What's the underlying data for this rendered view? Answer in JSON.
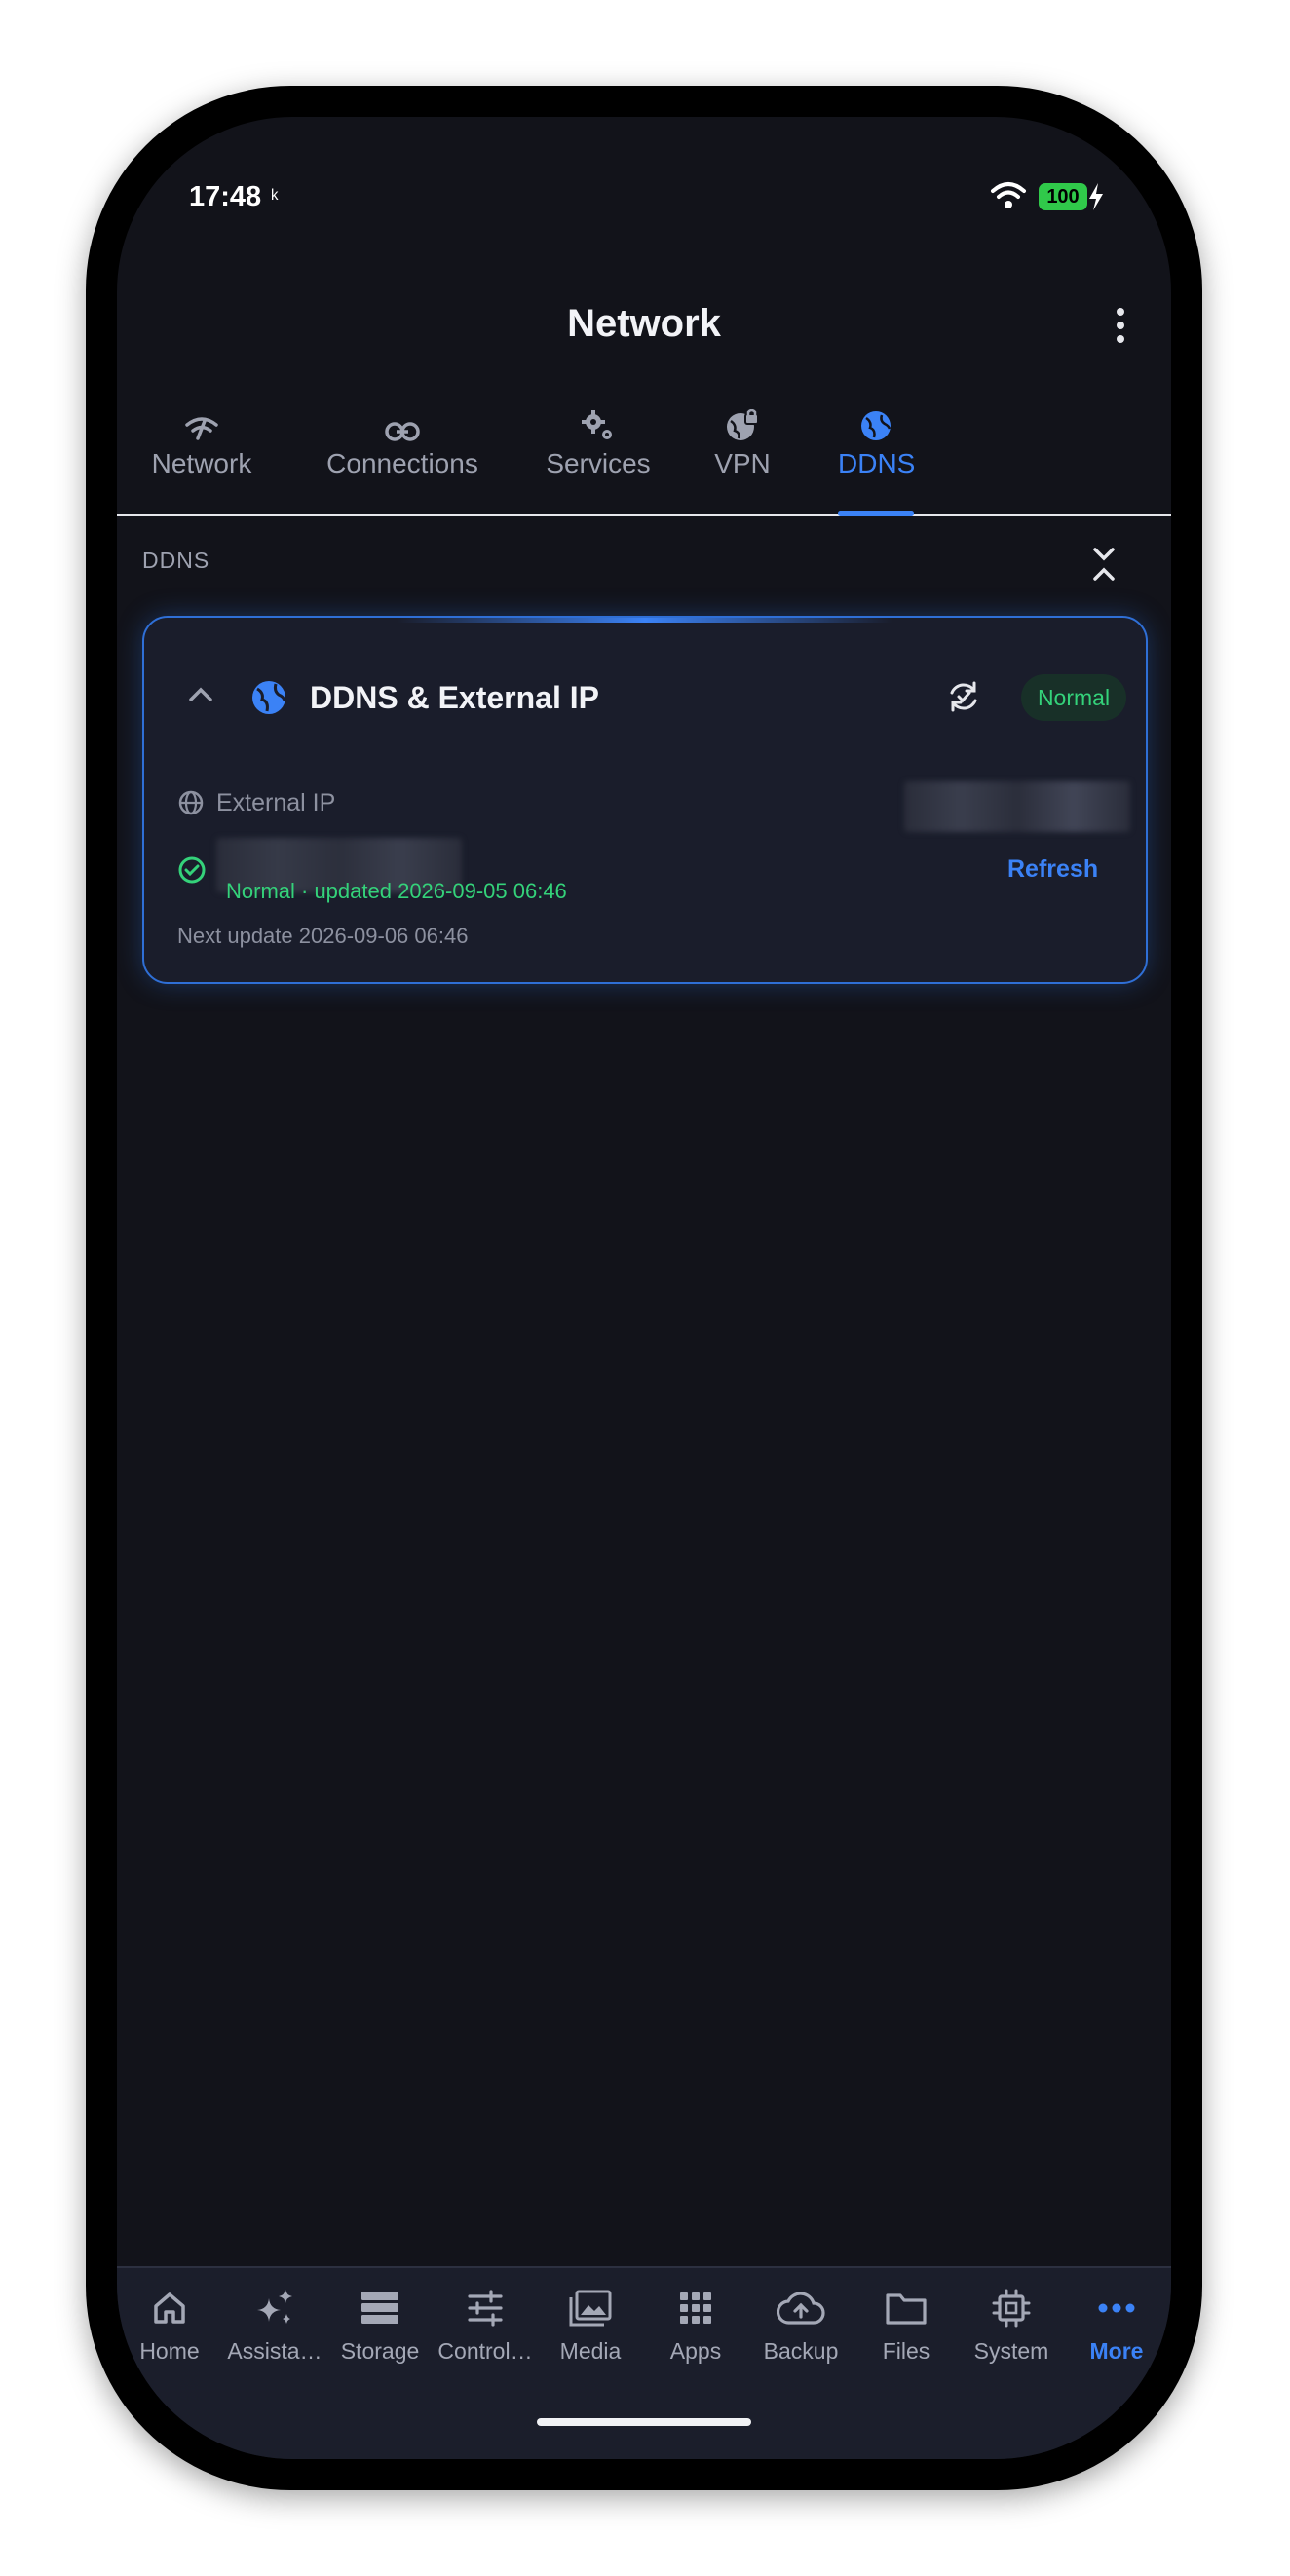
{
  "status_bar": {
    "time": "17:48",
    "time_extra": "ᵏ",
    "battery": "100"
  },
  "header": {
    "title": "Network"
  },
  "tabs": [
    {
      "label": "Network",
      "icon": "wifi-signal-icon"
    },
    {
      "label": "Connections",
      "icon": "link-icon"
    },
    {
      "label": "Services",
      "icon": "gears-icon"
    },
    {
      "label": "VPN",
      "icon": "globe-lock-icon"
    },
    {
      "label": "DDNS",
      "icon": "globe-icon",
      "active": true
    }
  ],
  "section": {
    "label": "DDNS"
  },
  "card": {
    "title": "DDNS & External IP",
    "badge": "Normal",
    "external_ip_label": "External IP",
    "status_text": "Normal · updated 2026-09-05 06:46",
    "refresh_label": "Refresh",
    "next_update": "Next update 2026-09-06 06:46"
  },
  "bottom_nav": [
    {
      "label": "Home",
      "icon": "home-icon"
    },
    {
      "label": "Assista…",
      "icon": "sparkles-icon"
    },
    {
      "label": "Storage",
      "icon": "storage-icon"
    },
    {
      "label": "Control…",
      "icon": "sliders-icon"
    },
    {
      "label": "Media",
      "icon": "media-icon"
    },
    {
      "label": "Apps",
      "icon": "apps-grid-icon"
    },
    {
      "label": "Backup",
      "icon": "cloud-upload-icon"
    },
    {
      "label": "Files",
      "icon": "folder-icon"
    },
    {
      "label": "System",
      "icon": "chip-icon"
    },
    {
      "label": "More",
      "icon": "more-dots-icon",
      "active": true
    }
  ],
  "colors": {
    "accent": "#3b82f6",
    "success": "#34d27a",
    "background": "#12131a",
    "card": "#1a1d2b"
  }
}
